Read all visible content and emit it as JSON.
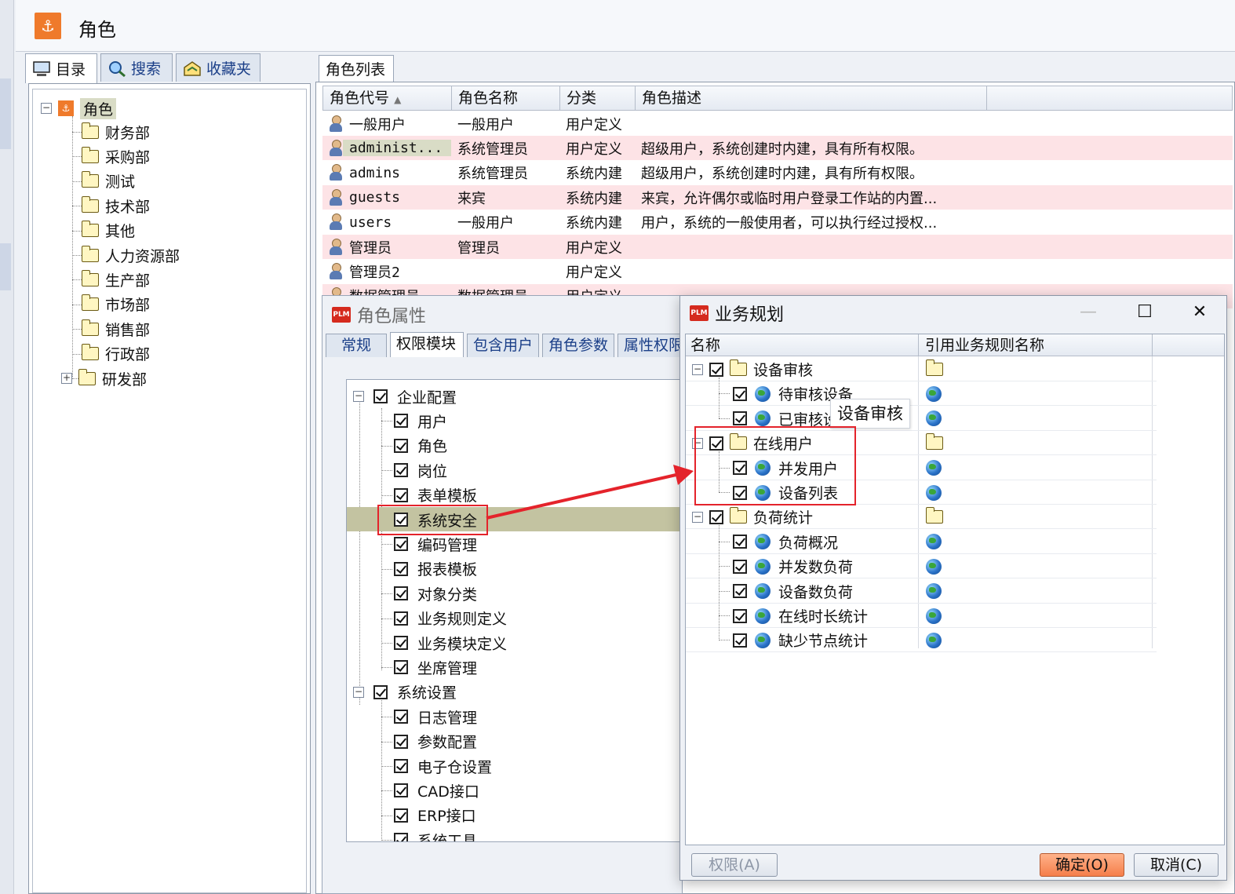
{
  "app": {
    "title": "角色"
  },
  "left_panel": {
    "tabs": [
      {
        "label": "目录"
      },
      {
        "label": "搜索"
      },
      {
        "label": "收藏夹"
      }
    ],
    "tree": {
      "root": "角色",
      "children": [
        "财务部",
        "采购部",
        "测试",
        "技术部",
        "其他",
        "人力资源部",
        "生产部",
        "市场部",
        "销售部",
        "行政部",
        "研发部"
      ]
    }
  },
  "role_list": {
    "tab": "角色列表",
    "columns": [
      "角色代号",
      "角色名称",
      "分类",
      "角色描述"
    ],
    "sort_indicator": "▲",
    "rows": [
      {
        "code": "一般用户",
        "name": "一般用户",
        "category": "用户定义",
        "desc": ""
      },
      {
        "code": "administ...",
        "name": "系统管理员",
        "category": "用户定义",
        "desc": "超级用户，系统创建时内建，具有所有权限。"
      },
      {
        "code": "admins",
        "name": "系统管理员",
        "category": "系统内建",
        "desc": "超级用户，系统创建时内建，具有所有权限。"
      },
      {
        "code": "guests",
        "name": "来宾",
        "category": "系统内建",
        "desc": "来宾，允许偶尔或临时用户登录工作站的内置..."
      },
      {
        "code": "users",
        "name": "一般用户",
        "category": "系统内建",
        "desc": "用户，系统的一般使用者，可以执行经过授权..."
      },
      {
        "code": "管理员",
        "name": "管理员",
        "category": "用户定义",
        "desc": ""
      },
      {
        "code": "管理员2",
        "name": "",
        "category": "用户定义",
        "desc": ""
      },
      {
        "code": "数据管理员",
        "name": "数据管理员",
        "category": "用户定义",
        "desc": ""
      }
    ]
  },
  "role_props": {
    "title": "角色属性",
    "tabs": [
      "常规",
      "权限模块",
      "包含用户",
      "角色参数",
      "属性权限"
    ],
    "tree": {
      "group1": "企业配置",
      "group1_items": [
        "用户",
        "角色",
        "岗位",
        "表单模板",
        "系统安全",
        "编码管理",
        "报表模板",
        "对象分类",
        "业务规则定义",
        "业务模块定义",
        "坐席管理"
      ],
      "group2": "系统设置",
      "group2_items": [
        "日志管理",
        "参数配置",
        "电子仓设置",
        "CAD接口",
        "ERP接口",
        "系统工具"
      ]
    }
  },
  "dialog": {
    "title": "业务规划",
    "columns": [
      "名称",
      "引用业务规则名称"
    ],
    "groups": [
      {
        "name": "设备审核",
        "items": [
          "待审核设备",
          "已审核设"
        ]
      },
      {
        "name": "在线用户",
        "items": [
          "并发用户",
          "设备列表"
        ]
      },
      {
        "name": "负荷统计",
        "items": [
          "负荷概况",
          "并发数负荷",
          "设备数负荷",
          "在线时长统计",
          "缺少节点统计"
        ]
      }
    ],
    "tooltip": "设备审核",
    "buttons": {
      "perm": "权限(A)",
      "ok": "确定(O)",
      "cancel": "取消(C)"
    },
    "controls": {
      "minimize": "—",
      "maximize": "☐",
      "close": "✕"
    }
  },
  "colors": {
    "accent": "#ef7a2b",
    "pink_row": "#fde3e6",
    "highlight": "#e4232b"
  }
}
